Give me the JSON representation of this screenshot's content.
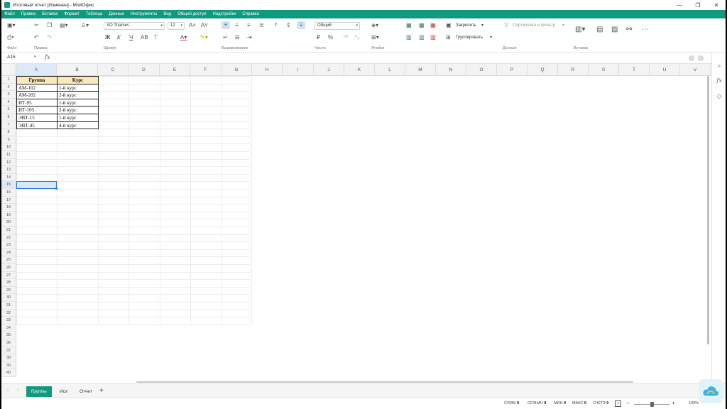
{
  "window": {
    "title": "Итоговый отчет [Изменен] - МойОфис",
    "controls": [
      "—",
      "❐",
      "✕"
    ]
  },
  "menu": [
    "Файл",
    "Правка",
    "Вставка",
    "Формат",
    "Таблица",
    "Данные",
    "Инструменты",
    "Вид",
    "Общий доступ",
    "Надстройки",
    "Справка"
  ],
  "ribbon": {
    "font_name": "XO Thames",
    "font_size": "12",
    "number_format": "Общий",
    "freeze_label": "Закрепить",
    "group_label": "Группировать",
    "sort_filter_label": "Сортировка и фильтр",
    "groups": {
      "file": "Файл",
      "edit": "Правка",
      "font": "Шрифт",
      "align": "Выравнивание",
      "number": "Число",
      "cells": "Ячейки",
      "data": "Данные",
      "insert": "Вставка"
    },
    "bold": "Ж",
    "italic": "К",
    "underline": "Ч",
    "strike": "АВ",
    "percent_btn": "%",
    "currency_btn": "₽"
  },
  "formula_bar": {
    "cell_ref": "A15",
    "fx": "fx",
    "formula": ""
  },
  "grid": {
    "columns": [
      "A",
      "B",
      "C",
      "D",
      "E",
      "F",
      "G",
      "H",
      "I",
      "J",
      "K",
      "L",
      "M",
      "N",
      "O",
      "P",
      "Q",
      "R",
      "S",
      "T",
      "U",
      "V"
    ],
    "rows": [
      "1",
      "2",
      "3",
      "4",
      "5",
      "6",
      "7",
      "8",
      "9",
      "10",
      "11",
      "12",
      "13",
      "14",
      "15",
      "16",
      "17",
      "18",
      "19",
      "20",
      "21",
      "22",
      "23",
      "24",
      "25",
      "26",
      "27",
      "28",
      "29",
      "30",
      "31",
      "32",
      "33",
      "34",
      "35",
      "36",
      "37",
      "38",
      "39",
      "40"
    ],
    "table": {
      "header": [
        "Группа",
        "Курс"
      ],
      "rows": [
        [
          "АМ-102",
          "1-й курс"
        ],
        [
          "АМ-202",
          "2-й курс"
        ],
        [
          "ИТ-95",
          "1-й курс"
        ],
        [
          "ИТ-105",
          "2-й курс"
        ],
        [
          "ЭВТ-15",
          "1-й курс"
        ],
        [
          "ЭВТ-45",
          "4-й курс"
        ]
      ]
    },
    "selected_cell": "A15"
  },
  "sheets": [
    {
      "name": "Группы",
      "active": true
    },
    {
      "name": "Исх",
      "active": false
    },
    {
      "name": "Отчет",
      "active": false
    }
  ],
  "status": {
    "sum_label": "СУММ",
    "sum": "0",
    "avg_label": "СРЗНАЧ",
    "avg": "0",
    "min_label": "МИН",
    "min": "0",
    "max_label": "МАКС",
    "max": "0",
    "count_label": "СЧЁТЗ",
    "count": "0",
    "zoom": "100%"
  },
  "colors": {
    "accent": "#0f9a7f",
    "header_fill": "#fbe8b9",
    "selection": "#2b78d6"
  }
}
